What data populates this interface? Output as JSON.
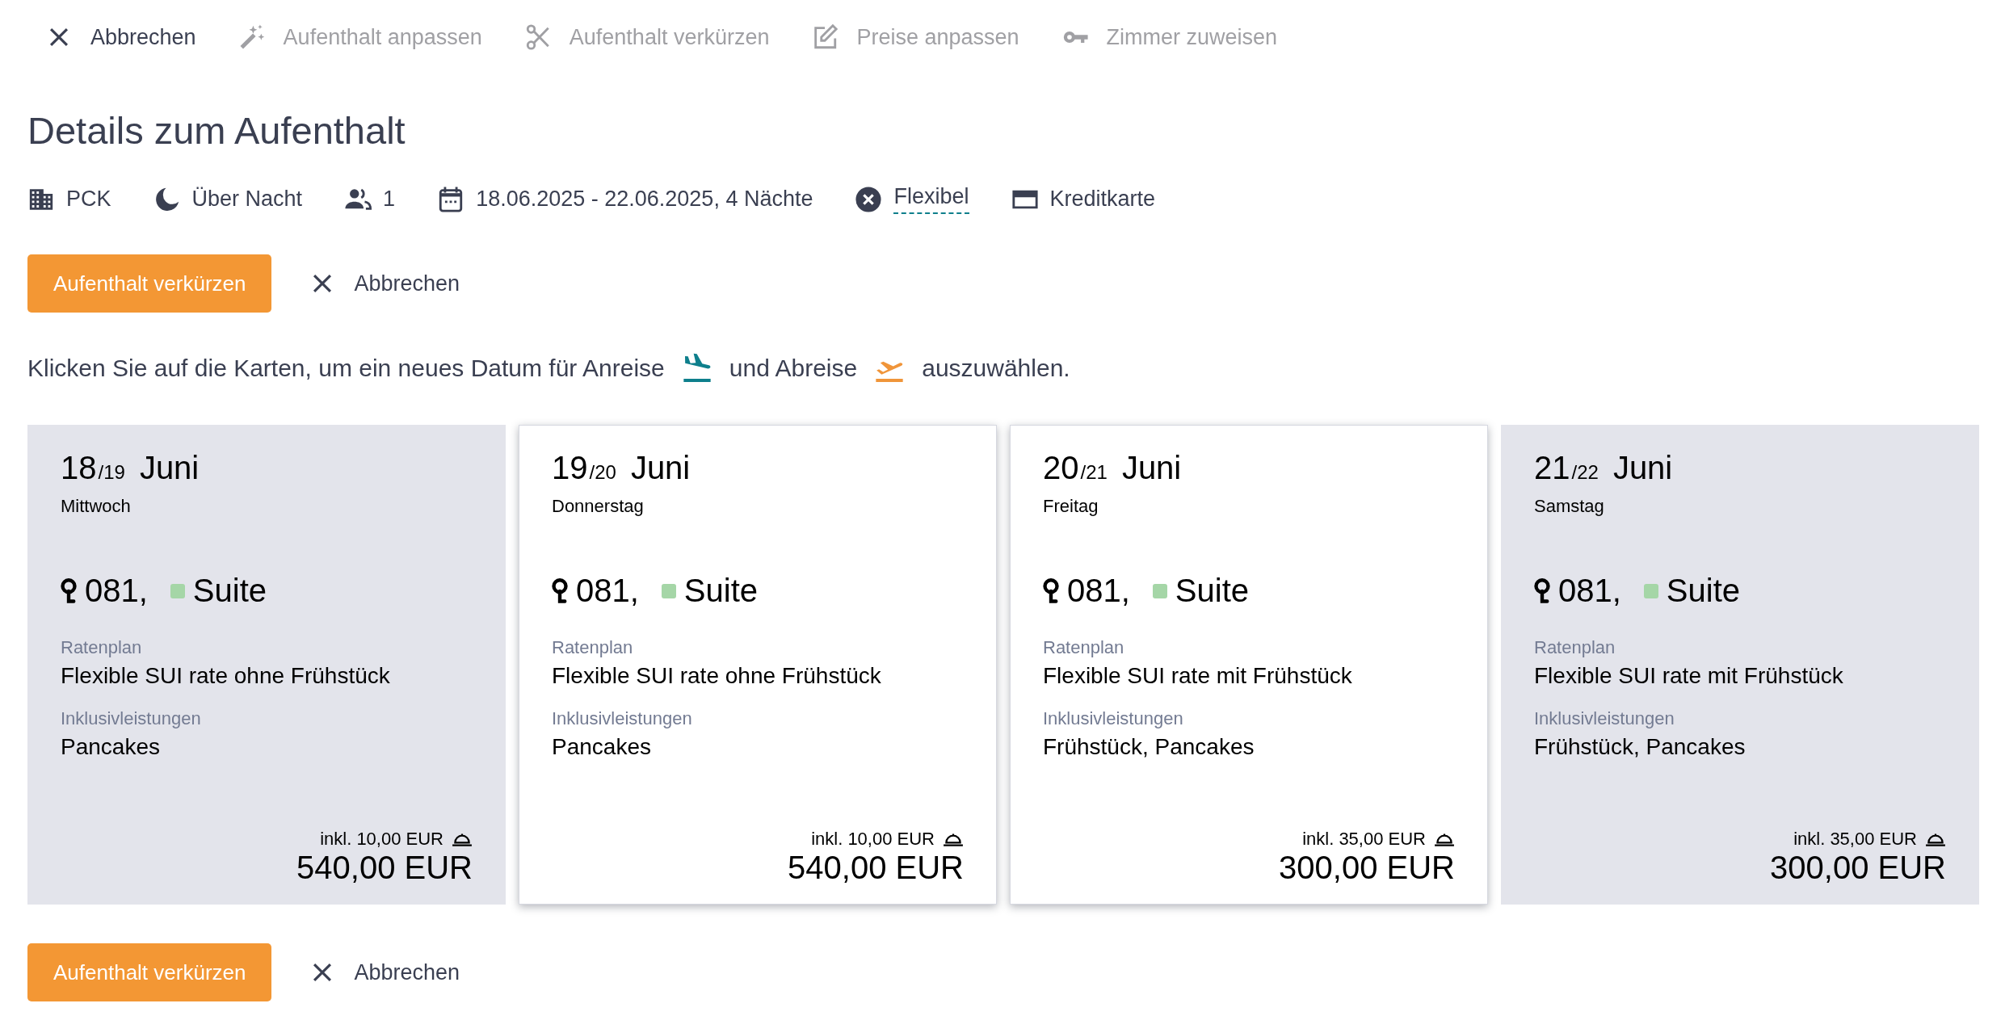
{
  "toolbar": [
    {
      "label": "Abbrechen",
      "disabled": false
    },
    {
      "label": "Aufenthalt anpassen",
      "disabled": true
    },
    {
      "label": "Aufenthalt verkürzen",
      "disabled": true
    },
    {
      "label": "Preise anpassen",
      "disabled": true
    },
    {
      "label": "Zimmer zuweisen",
      "disabled": true
    }
  ],
  "page_title": "Details zum Aufenthalt",
  "info": [
    {
      "text": "PCK",
      "kind": "plain"
    },
    {
      "text": "Über Nacht",
      "kind": "plain"
    },
    {
      "text": "1",
      "kind": "plain"
    },
    {
      "text": "18.06.2025 - 22.06.2025, 4 Nächte",
      "kind": "plain"
    },
    {
      "text": "Flexibel",
      "kind": "link"
    },
    {
      "text": "Kreditkarte",
      "kind": "plain"
    }
  ],
  "actions_top": {
    "primary": "Aufenthalt verkürzen",
    "cancel": "Abbrechen"
  },
  "instruction": {
    "before": "Klicken Sie auf die Karten, um ein neues Datum für Anreise",
    "middle": "und Abreise",
    "after": "auszuwählen."
  },
  "cards": [
    {
      "day": "18",
      "next_day": "/19",
      "month": "Juni",
      "weekday": "Mittwoch",
      "room": "081,",
      "category": "Suite",
      "rate_plan_label": "Ratenplan",
      "rate_plan": "Flexible SUI rate ohne Frühstück",
      "inclusions_label": "Inklusivleistungen",
      "inclusions": "Pancakes",
      "included_amount": "inkl. 10,00 EUR",
      "total": "540,00 EUR",
      "selected": false
    },
    {
      "day": "19",
      "next_day": "/20",
      "month": "Juni",
      "weekday": "Donnerstag",
      "room": "081,",
      "category": "Suite",
      "rate_plan_label": "Ratenplan",
      "rate_plan": "Flexible SUI rate ohne Frühstück",
      "inclusions_label": "Inklusivleistungen",
      "inclusions": "Pancakes",
      "included_amount": "inkl. 10,00 EUR",
      "total": "540,00 EUR",
      "selected": true
    },
    {
      "day": "20",
      "next_day": "/21",
      "month": "Juni",
      "weekday": "Freitag",
      "room": "081,",
      "category": "Suite",
      "rate_plan_label": "Ratenplan",
      "rate_plan": "Flexible SUI rate mit Frühstück",
      "inclusions_label": "Inklusivleistungen",
      "inclusions": "Frühstück, Pancakes",
      "included_amount": "inkl. 35,00 EUR",
      "total": "300,00 EUR",
      "selected": true
    },
    {
      "day": "21",
      "next_day": "/22",
      "month": "Juni",
      "weekday": "Samstag",
      "room": "081,",
      "category": "Suite",
      "rate_plan_label": "Ratenplan",
      "rate_plan": "Flexible SUI rate mit Frühstück",
      "inclusions_label": "Inklusivleistungen",
      "inclusions": "Frühstück, Pancakes",
      "included_amount": "inkl. 35,00 EUR",
      "total": "300,00 EUR",
      "selected": false
    }
  ],
  "actions_bottom": {
    "primary": "Aufenthalt verkürzen",
    "cancel": "Abbrechen"
  }
}
